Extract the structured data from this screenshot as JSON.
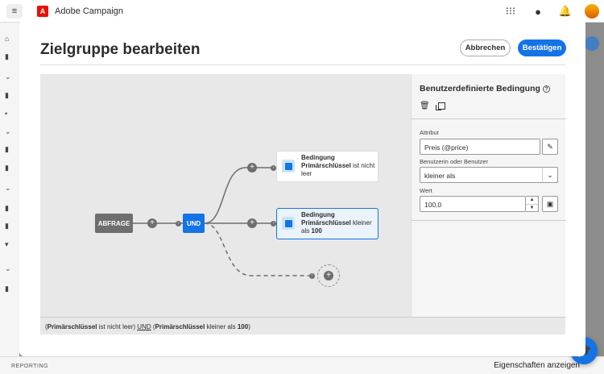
{
  "app": {
    "title": "Adobe Campaign",
    "menu_icon": "hamburger-icon",
    "reporting_label": "REPORTING",
    "properties_link": "Eigenschaften anzeigen"
  },
  "modal": {
    "title": "Zielgruppe bearbeiten",
    "cancel_label": "Abbrechen",
    "confirm_label": "Bestätigen"
  },
  "canvas": {
    "start_node": "ABFRAGE",
    "operator_node": "UND",
    "conditions": [
      {
        "heading": "Bedingung",
        "attribute": "Primärschlüssel",
        "text": "ist nicht leer",
        "value": ""
      },
      {
        "heading": "Bedingung",
        "attribute": "Primärschlüssel",
        "text": "kleiner als",
        "value": "100"
      }
    ]
  },
  "summary": {
    "part1_attr": "Primärschlüssel",
    "part1_text": "ist nicht leer",
    "operator": "UND",
    "part2_attr": "Primärschlüssel",
    "part2_text": "kleiner als",
    "part2_value": "100"
  },
  "panel": {
    "title": "Benutzerdefinierte Bedingung",
    "attribute_label": "Attribut",
    "attribute_value": "Preis (@price)",
    "operator_label": "Benutzerin oder Benutzer",
    "operator_value": "kleiner als",
    "value_label": "Wert",
    "value_value": "100,0"
  },
  "colors": {
    "accent": "#1473e6",
    "node_grey": "#6e6e6e",
    "canvas_bg": "#e8e8e8"
  }
}
